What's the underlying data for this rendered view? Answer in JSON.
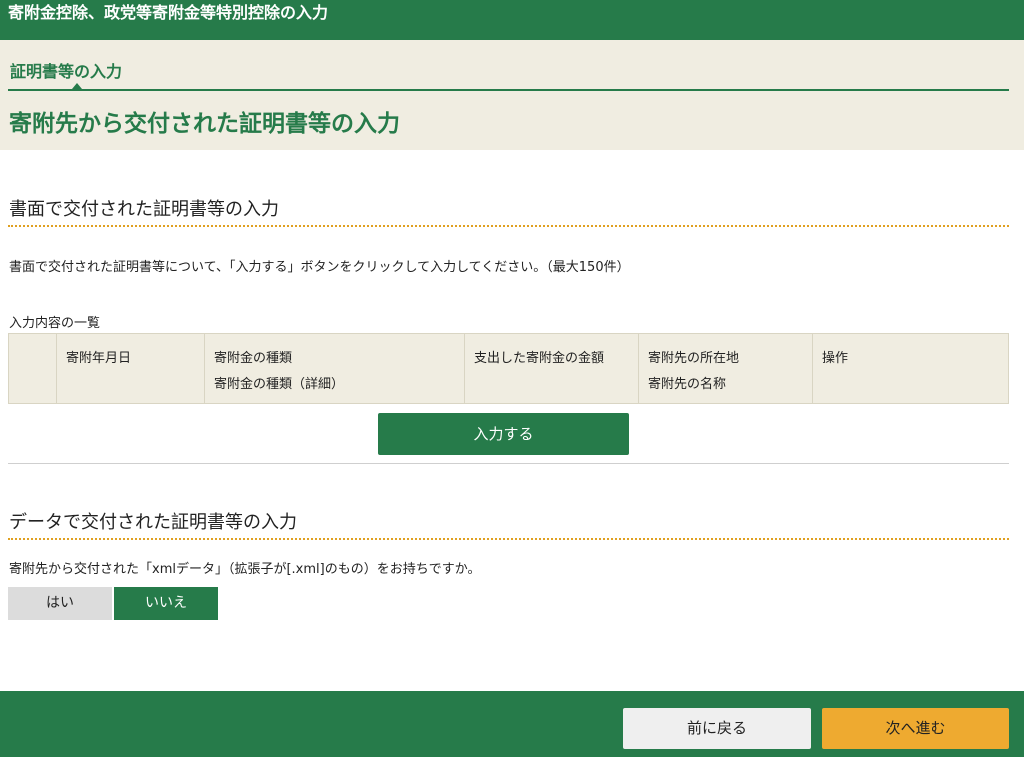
{
  "window": {
    "title": "寄附金控除、政党等寄附金等特別控除の入力"
  },
  "header": {
    "step_label": "証明書等の入力",
    "page_title": "寄附先から交付された証明書等の入力"
  },
  "paper_section": {
    "heading": "書面で交付された証明書等の入力",
    "description": "書面で交付された証明書等について、「入力する」ボタンをクリックして入力してください。（最大150件）",
    "list_caption": "入力内容の一覧",
    "table": {
      "columns": [
        {
          "line1": "",
          "line2": ""
        },
        {
          "line1": "寄附年月日",
          "line2": ""
        },
        {
          "line1": "寄附金の種類",
          "line2": "寄附金の種類（詳細）"
        },
        {
          "line1": "支出した寄附金の金額",
          "line2": ""
        },
        {
          "line1": "寄附先の所在地",
          "line2": "寄附先の名称"
        },
        {
          "line1": "操作",
          "line2": ""
        }
      ]
    },
    "input_button": "入力する"
  },
  "data_section": {
    "heading": "データで交付された証明書等の入力",
    "question": "寄附先から交付された「xmlデータ」（拡張子が[.xml]のもの）をお持ちですか。",
    "yes_label": "はい",
    "no_label": "いいえ",
    "selected": "いいえ"
  },
  "footer": {
    "back_label": "前に戻る",
    "next_label": "次へ進む"
  },
  "colors": {
    "brand_green": "#267b4a",
    "band_beige": "#f0ede1",
    "accent_orange": "#eeaa30",
    "dotted_rule": "#e0a020"
  }
}
